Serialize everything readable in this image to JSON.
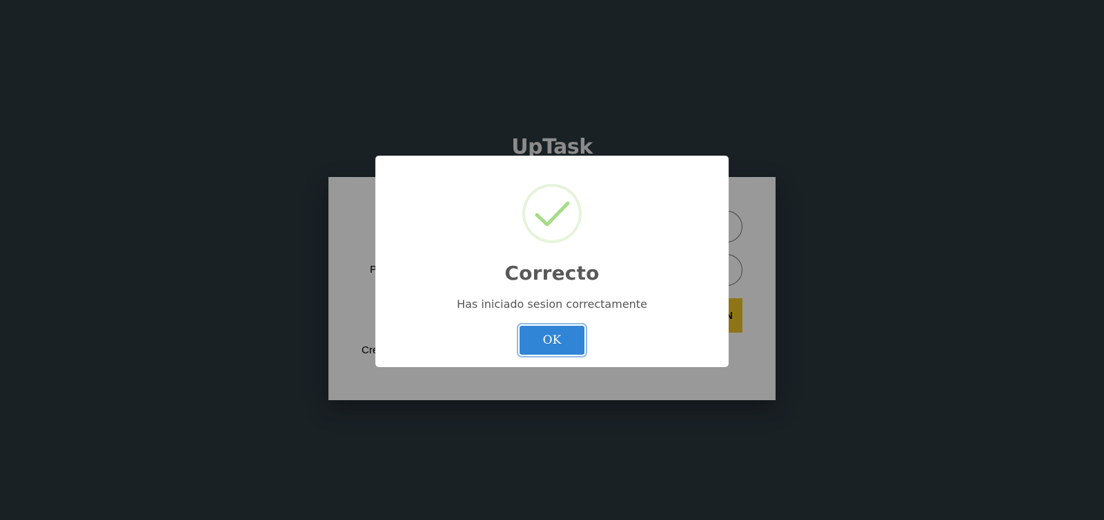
{
  "app": {
    "title": "UpTask"
  },
  "login_form": {
    "email_label": "",
    "email_value": "",
    "password_label": "P",
    "password_value": "",
    "submit_label": "N",
    "create_account_link": "Cre"
  },
  "modal": {
    "icon": "success-check-icon",
    "title": "Correcto",
    "message": "Has iniciado sesion correctamente",
    "confirm_label": "OK"
  },
  "colors": {
    "background": "#2b373e",
    "overlay": "rgba(0,0,0,0.4)",
    "login_button": "#f0c329",
    "success_icon": "#a5dc86",
    "confirm_button": "#3085d6"
  }
}
